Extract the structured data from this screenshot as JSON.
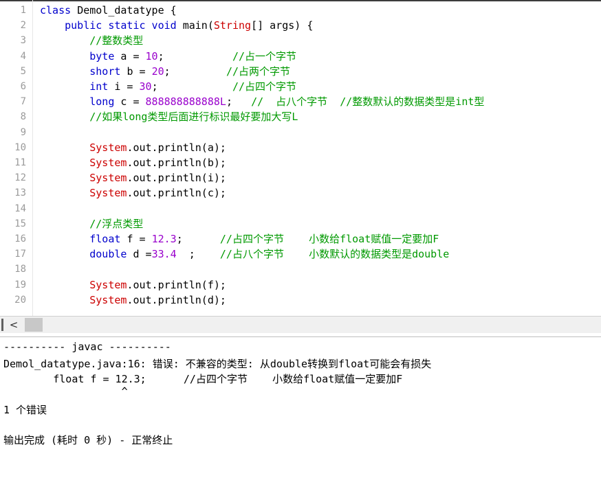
{
  "editor": {
    "lines": [
      {
        "n": "1",
        "segs": [
          {
            "t": "class ",
            "c": "kw"
          },
          {
            "t": "Demol_datatype {",
            "c": ""
          }
        ]
      },
      {
        "n": "2",
        "segs": [
          {
            "t": "    public static void ",
            "c": "kw"
          },
          {
            "t": "main(",
            "c": ""
          },
          {
            "t": "String",
            "c": "cls"
          },
          {
            "t": "[] args) {",
            "c": ""
          }
        ]
      },
      {
        "n": "3",
        "segs": [
          {
            "t": "        //整数类型",
            "c": "cm"
          }
        ]
      },
      {
        "n": "4",
        "segs": [
          {
            "t": "        byte ",
            "c": "kw"
          },
          {
            "t": "a = ",
            "c": ""
          },
          {
            "t": "10",
            "c": "num"
          },
          {
            "t": ";           ",
            "c": ""
          },
          {
            "t": "//占一个字节",
            "c": "cm"
          }
        ]
      },
      {
        "n": "5",
        "segs": [
          {
            "t": "        short ",
            "c": "kw"
          },
          {
            "t": "b = ",
            "c": ""
          },
          {
            "t": "20",
            "c": "num"
          },
          {
            "t": ";         ",
            "c": ""
          },
          {
            "t": "//占两个字节",
            "c": "cm"
          }
        ]
      },
      {
        "n": "6",
        "segs": [
          {
            "t": "        int ",
            "c": "kw"
          },
          {
            "t": "i = ",
            "c": ""
          },
          {
            "t": "30",
            "c": "num"
          },
          {
            "t": ";            ",
            "c": ""
          },
          {
            "t": "//占四个字节",
            "c": "cm"
          }
        ]
      },
      {
        "n": "7",
        "segs": [
          {
            "t": "        long ",
            "c": "kw"
          },
          {
            "t": "c = ",
            "c": ""
          },
          {
            "t": "888888888888L",
            "c": "num"
          },
          {
            "t": ";   ",
            "c": ""
          },
          {
            "t": "//  占八个字节  //整数默认的数据类型是int型",
            "c": "cm"
          }
        ]
      },
      {
        "n": "8",
        "segs": [
          {
            "t": "        //如果long类型后面进行标识最好要加大写L",
            "c": "cm"
          }
        ]
      },
      {
        "n": "9",
        "segs": []
      },
      {
        "n": "10",
        "segs": [
          {
            "t": "        System",
            "c": "cls"
          },
          {
            "t": ".out.println(a);",
            "c": ""
          }
        ]
      },
      {
        "n": "11",
        "segs": [
          {
            "t": "        System",
            "c": "cls"
          },
          {
            "t": ".out.println(b);",
            "c": ""
          }
        ]
      },
      {
        "n": "12",
        "segs": [
          {
            "t": "        System",
            "c": "cls"
          },
          {
            "t": ".out.println(i);",
            "c": ""
          }
        ]
      },
      {
        "n": "13",
        "segs": [
          {
            "t": "        System",
            "c": "cls"
          },
          {
            "t": ".out.println(c);",
            "c": ""
          }
        ]
      },
      {
        "n": "14",
        "segs": []
      },
      {
        "n": "15",
        "segs": [
          {
            "t": "        //浮点类型",
            "c": "cm"
          }
        ]
      },
      {
        "n": "16",
        "segs": [
          {
            "t": "        float ",
            "c": "kw"
          },
          {
            "t": "f = ",
            "c": ""
          },
          {
            "t": "12.3",
            "c": "num"
          },
          {
            "t": ";      ",
            "c": ""
          },
          {
            "t": "//占四个字节    小数给float赋值一定要加F",
            "c": "cm"
          }
        ]
      },
      {
        "n": "17",
        "segs": [
          {
            "t": "        double ",
            "c": "kw"
          },
          {
            "t": "d =",
            "c": ""
          },
          {
            "t": "33.4",
            "c": "num"
          },
          {
            "t": "  ;    ",
            "c": ""
          },
          {
            "t": "//占八个字节    小数默认的数据类型是double",
            "c": "cm"
          }
        ]
      },
      {
        "n": "18",
        "segs": []
      },
      {
        "n": "19",
        "segs": [
          {
            "t": "        System",
            "c": "cls"
          },
          {
            "t": ".out.println(f);",
            "c": ""
          }
        ]
      },
      {
        "n": "20",
        "segs": [
          {
            "t": "        System",
            "c": "cls"
          },
          {
            "t": ".out.println(d);",
            "c": ""
          }
        ]
      }
    ]
  },
  "scrollbar": {
    "left_arrow": "<"
  },
  "output": {
    "lines": [
      "---------- javac ----------",
      "Demol_datatype.java:16: 错误: 不兼容的类型: 从double转换到float可能会有损失",
      "        float f = 12.3;      //占四个字节    小数给float赋值一定要加F",
      "                   ^",
      "1 个错误",
      "",
      "输出完成 (耗时 0 秒) - 正常终止"
    ]
  },
  "colors": {
    "keyword": "#0000cc",
    "comment": "#009900",
    "number": "#9900cc",
    "class": "#cc0000",
    "line_number": "#9a9a9a"
  }
}
